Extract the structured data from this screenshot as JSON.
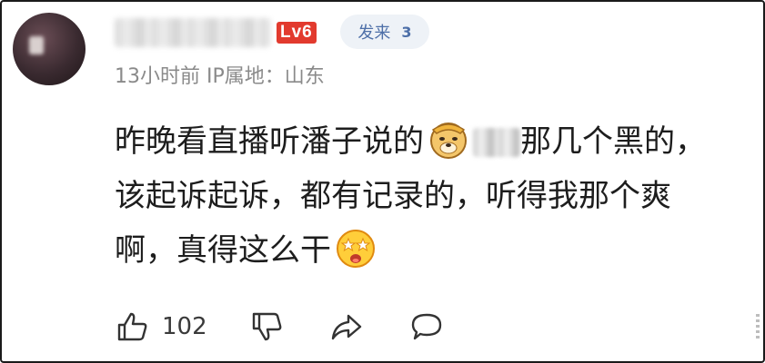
{
  "comment": {
    "level_badge": "Lv6",
    "sender_label": "发来",
    "sender_count": "3",
    "time": "13小时前",
    "ip_location": "IP属地：山东",
    "text_line1_before": "昨晚看直播听潘子说的",
    "text_line1_after": "那几个黑的，",
    "text_line2": "该起诉起诉，都有记录的，听得我那个爽",
    "text_line3": "啊，真得这么干",
    "emoji_1": "doge-emoji",
    "emoji_2": "star-eyes-emoji"
  },
  "actions": {
    "like_count": "102"
  },
  "colors": {
    "level_badge_bg": "#e23a2e",
    "pill_bg": "#eef2f7",
    "pill_text": "#4d6fa8",
    "meta_text": "#8a8a8a"
  }
}
